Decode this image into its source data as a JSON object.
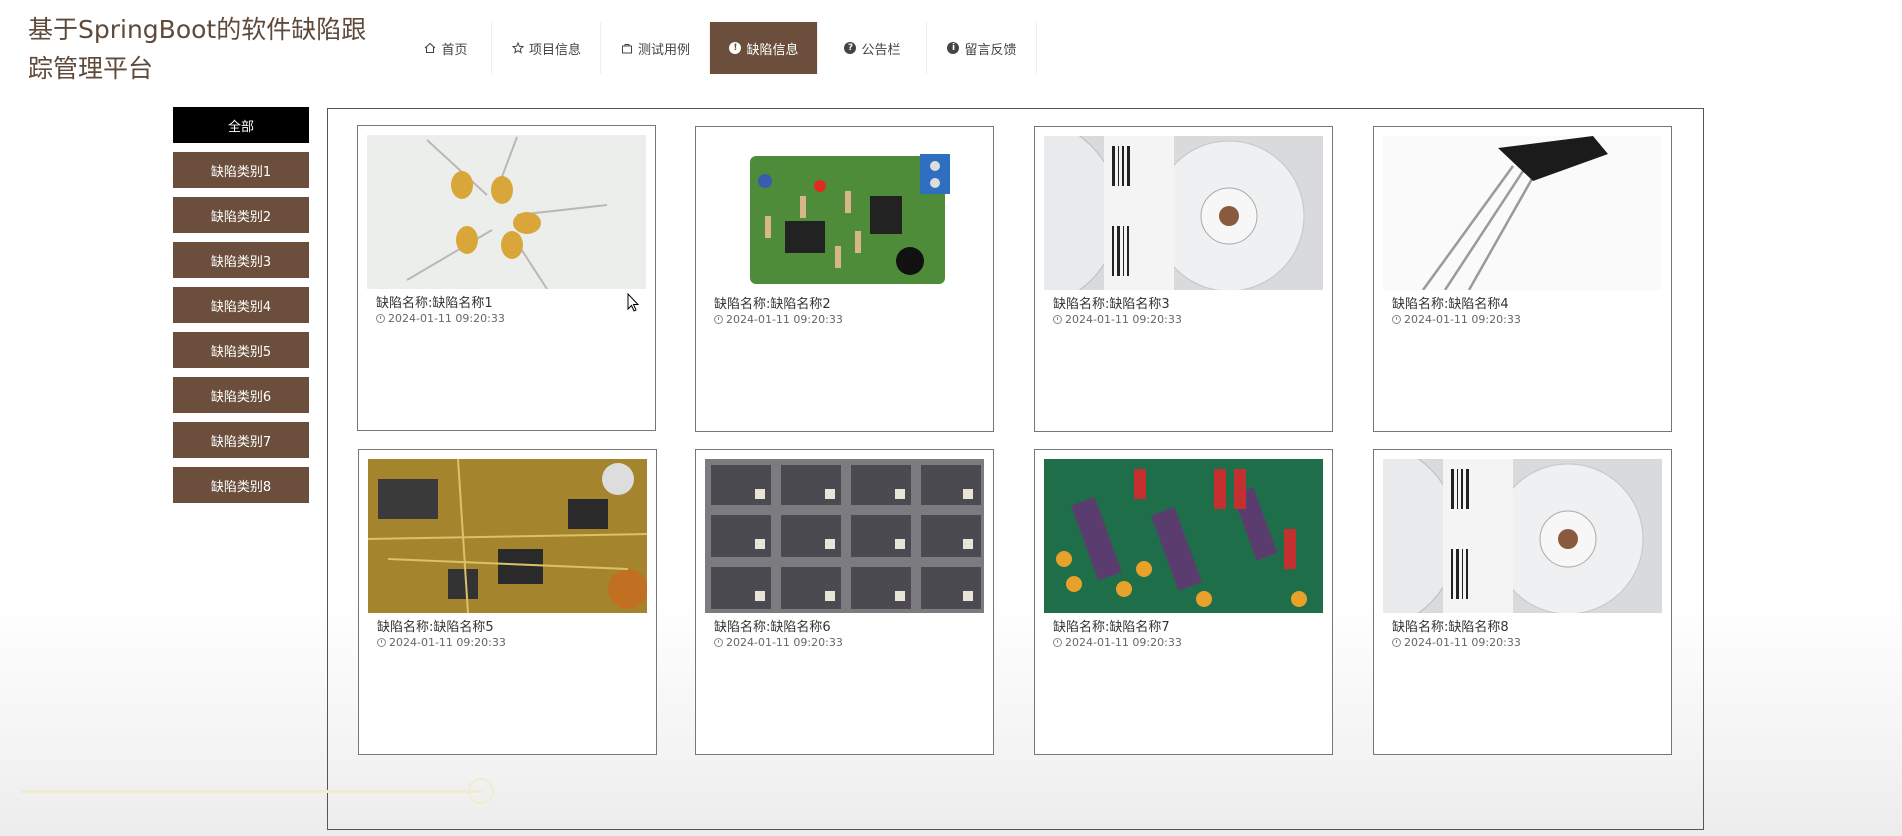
{
  "site": {
    "title": "基于SpringBoot的软件缺陷跟踪管理平台"
  },
  "nav": [
    {
      "label": "首页",
      "icon": "home-icon",
      "active": false
    },
    {
      "label": "项目信息",
      "icon": "star-icon",
      "active": false
    },
    {
      "label": "测试用例",
      "icon": "bag-icon",
      "active": false
    },
    {
      "label": "缺陷信息",
      "icon": "exclamation-circle-icon",
      "active": true
    },
    {
      "label": "公告栏",
      "icon": "question-circle-icon",
      "active": false
    },
    {
      "label": "留言反馈",
      "icon": "info-circle-icon",
      "active": false
    }
  ],
  "categories": [
    {
      "label": "全部",
      "active": true
    },
    {
      "label": "缺陷类别1"
    },
    {
      "label": "缺陷类别2"
    },
    {
      "label": "缺陷类别3"
    },
    {
      "label": "缺陷类别4"
    },
    {
      "label": "缺陷类别5"
    },
    {
      "label": "缺陷类别6"
    },
    {
      "label": "缺陷类别7"
    },
    {
      "label": "缺陷类别8"
    }
  ],
  "cards": [
    {
      "name": "缺陷名称:缺陷名称1",
      "time": "2024-01-11 09:20:33",
      "image": "capacitors-photo"
    },
    {
      "name": "缺陷名称:缺陷名称2",
      "time": "2024-01-11 09:20:33",
      "image": "circuit-board-photo"
    },
    {
      "name": "缺陷名称:缺陷名称3",
      "time": "2024-01-11 09:20:33",
      "image": "component-reel-photo"
    },
    {
      "name": "缺陷名称:缺陷名称4",
      "time": "2024-01-11 09:20:33",
      "image": "transistor-photo"
    },
    {
      "name": "缺陷名称:缺陷名称5",
      "time": "2024-01-11 09:20:33",
      "image": "pcb-closeup-photo"
    },
    {
      "name": "缺陷名称:缺陷名称6",
      "time": "2024-01-11 09:20:33",
      "image": "chips-grid-photo"
    },
    {
      "name": "缺陷名称:缺陷名称7",
      "time": "2024-01-11 09:20:33",
      "image": "green-pcb-photo"
    },
    {
      "name": "缺陷名称:缺陷名称8",
      "time": "2024-01-11 09:20:33",
      "image": "component-reel-photo"
    }
  ],
  "colors": {
    "accent": "#6b4f3c",
    "active_category": "#000000",
    "title": "#5f4a3a"
  }
}
